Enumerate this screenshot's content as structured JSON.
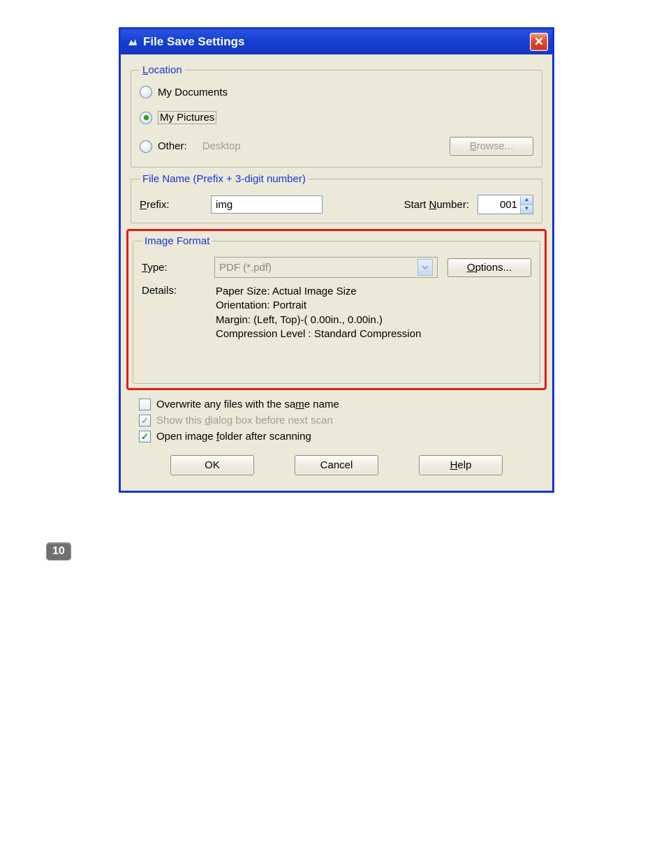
{
  "step_badge": "10",
  "dialog": {
    "title": "File Save Settings",
    "location": {
      "legend": "Location",
      "options": {
        "my_documents": "My Documents",
        "my_pictures": "My Pictures",
        "other_label": "Other:",
        "other_path": "Desktop"
      },
      "browse_label": "Browse..."
    },
    "filename": {
      "legend": "File Name (Prefix + 3-digit number)",
      "prefix_label": "Prefix:",
      "prefix_value": "img",
      "start_label": "Start Number:",
      "start_value": "001"
    },
    "image_format": {
      "legend": "Image Format",
      "type_label": "Type:",
      "type_value": "PDF (*.pdf)",
      "options_label": "Options...",
      "details_label": "Details:",
      "details_lines": [
        "Paper Size: Actual Image Size",
        "Orientation: Portrait",
        "Margin: (Left, Top)-( 0.00in., 0.00in.)",
        "Compression Level : Standard Compression"
      ]
    },
    "checks": {
      "overwrite": "Overwrite any files with the same name",
      "show_dialog": "Show this dialog box before next scan",
      "open_folder": "Open image folder after scanning"
    },
    "buttons": {
      "ok": "OK",
      "cancel": "Cancel",
      "help": "Help"
    }
  }
}
